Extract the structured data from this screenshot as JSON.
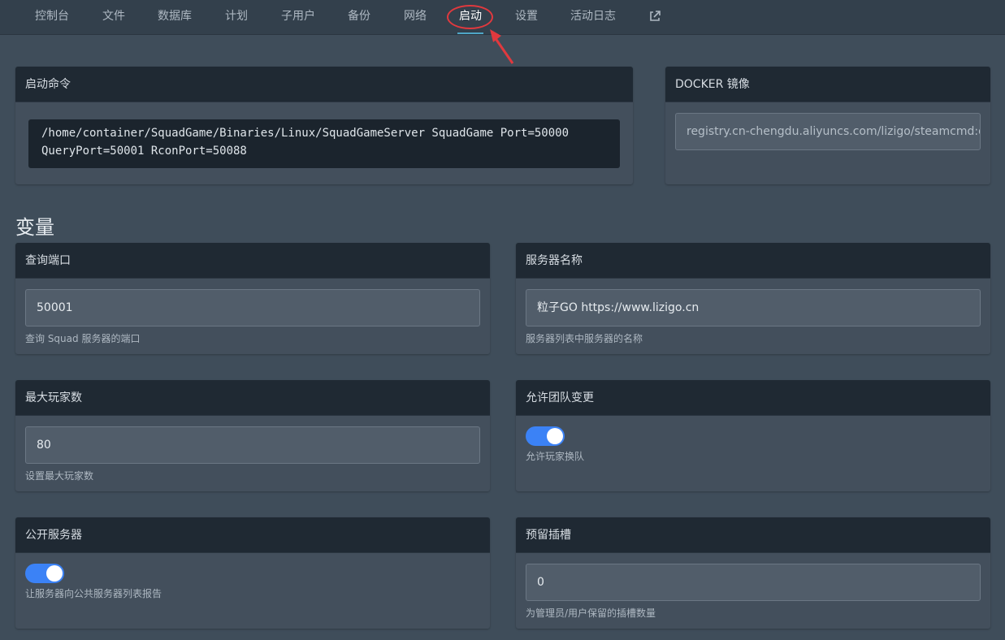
{
  "nav": {
    "items": [
      {
        "label": "控制台"
      },
      {
        "label": "文件"
      },
      {
        "label": "数据库"
      },
      {
        "label": "计划"
      },
      {
        "label": "子用户"
      },
      {
        "label": "备份"
      },
      {
        "label": "网络"
      },
      {
        "label": "启动",
        "active": true
      },
      {
        "label": "设置"
      },
      {
        "label": "活动日志"
      }
    ],
    "external_icon": "external-link-icon"
  },
  "startup": {
    "title": "启动命令",
    "command_line1": "/home/container/SquadGame/Binaries/Linux/SquadGameServer SquadGame Port=50000",
    "command_line2": "QueryPort=50001 RconPort=50088"
  },
  "docker": {
    "title": "DOCKER 镜像",
    "value": "registry.cn-chengdu.aliyuncs.com/lizigo/steamcmd:d"
  },
  "variables": {
    "title": "变量",
    "query_port": {
      "label": "查询端口",
      "value": "50001",
      "hint": "查询 Squad 服务器的端口"
    },
    "server_name": {
      "label": "服务器名称",
      "value": "粒子GO https://www.lizigo.cn",
      "hint": "服务器列表中服务器的名称"
    },
    "max_players": {
      "label": "最大玩家数",
      "value": "80",
      "hint": "设置最大玩家数"
    },
    "team_change": {
      "label": "允许团队变更",
      "enabled": true,
      "hint": "允许玩家换队"
    },
    "public_server": {
      "label": "公开服务器",
      "enabled": true,
      "hint": "让服务器向公共服务器列表报告"
    },
    "reserved_slots": {
      "label": "预留插槽",
      "value": "0",
      "hint": "为管理员/用户保留的插槽数量"
    }
  },
  "colors": {
    "accent": "#3b82f6",
    "active_tab_underline": "#4fa6c7",
    "annotation": "#e0393e"
  }
}
